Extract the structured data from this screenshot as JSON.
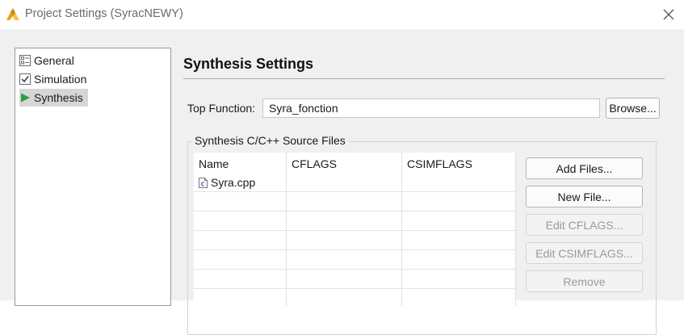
{
  "window": {
    "title": "Project Settings (SyracNEWY)",
    "app_icon": "vivado-hls-logo-icon",
    "close_icon": "close-icon"
  },
  "nav": {
    "items": [
      {
        "label": "General",
        "icon": "general-settings-icon",
        "selected": false
      },
      {
        "label": "Simulation",
        "icon": "checkbox-checked-icon",
        "selected": false
      },
      {
        "label": "Synthesis",
        "icon": "play-arrow-icon",
        "selected": true
      }
    ]
  },
  "synthesis": {
    "heading": "Synthesis Settings",
    "top_function_label": "Top Function:",
    "top_function_value": "Syra_fonction",
    "browse_label": "Browse...",
    "source_files_group": "Synthesis C/C++ Source Files",
    "table": {
      "columns": [
        "Name",
        "CFLAGS",
        "CSIMFLAGS"
      ],
      "rows": [
        {
          "name": "Syra.cpp",
          "icon": "c-source-file-icon",
          "cflags": "",
          "csimflags": ""
        }
      ]
    },
    "buttons": {
      "add_files": "Add Files...",
      "new_file": "New File...",
      "edit_cflags": "Edit CFLAGS...",
      "edit_csimflags": "Edit CSIMFLAGS...",
      "remove": "Remove"
    }
  },
  "colors": {
    "accent_green": "#2e9e3c",
    "logo_orange": "#e8a317",
    "panel_background": "#f0f0f0",
    "disabled_text": "#9a9a9a"
  }
}
